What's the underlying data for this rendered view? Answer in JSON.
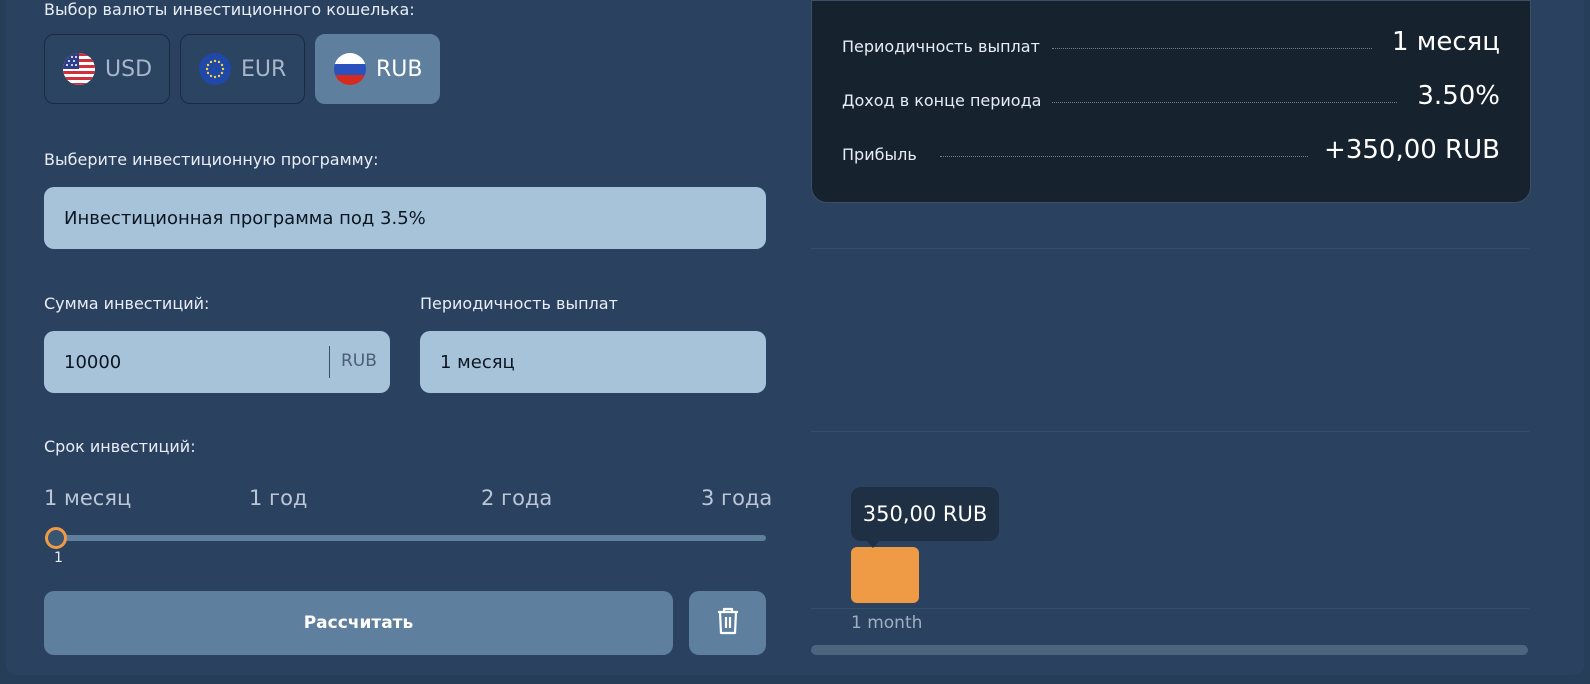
{
  "currency": {
    "label": "Выбор валюты инвестиционного кошелька:",
    "options": [
      {
        "code": "USD",
        "active": false
      },
      {
        "code": "EUR",
        "active": false
      },
      {
        "code": "RUB",
        "active": true
      }
    ]
  },
  "program": {
    "label": "Выберите инвестиционную программу:",
    "value": "Инвестиционная программа под 3.5%"
  },
  "amount": {
    "label": "Сумма инвестиций:",
    "value": "10000",
    "unit": "RUB"
  },
  "payout": {
    "label": "Периодичность выплат",
    "value": "1 месяц"
  },
  "term": {
    "label": "Срок инвестиций:",
    "ticks": [
      "1 месяц",
      "1 год",
      "2 года",
      "3 года"
    ],
    "value_label": "1",
    "value_fraction": 0
  },
  "actions": {
    "calculate": "Рассчитать",
    "delete_icon": "trash-icon"
  },
  "summary": {
    "rows": [
      {
        "key": "Периодичность выплат",
        "value": "1 месяц"
      },
      {
        "key": "Доход в конце периода",
        "value": "3.50%"
      },
      {
        "key": "Прибыль",
        "value": "+350,00 RUB"
      }
    ]
  },
  "chart_data": {
    "type": "bar",
    "categories": [
      "1 month"
    ],
    "values": [
      350
    ],
    "tooltip": "350,00 RUB",
    "color": "#ef9a45"
  },
  "colors": {
    "accent_orange": "#ef9a45",
    "input_bg": "#a7c3da",
    "button_bg": "#5f7f9e"
  }
}
